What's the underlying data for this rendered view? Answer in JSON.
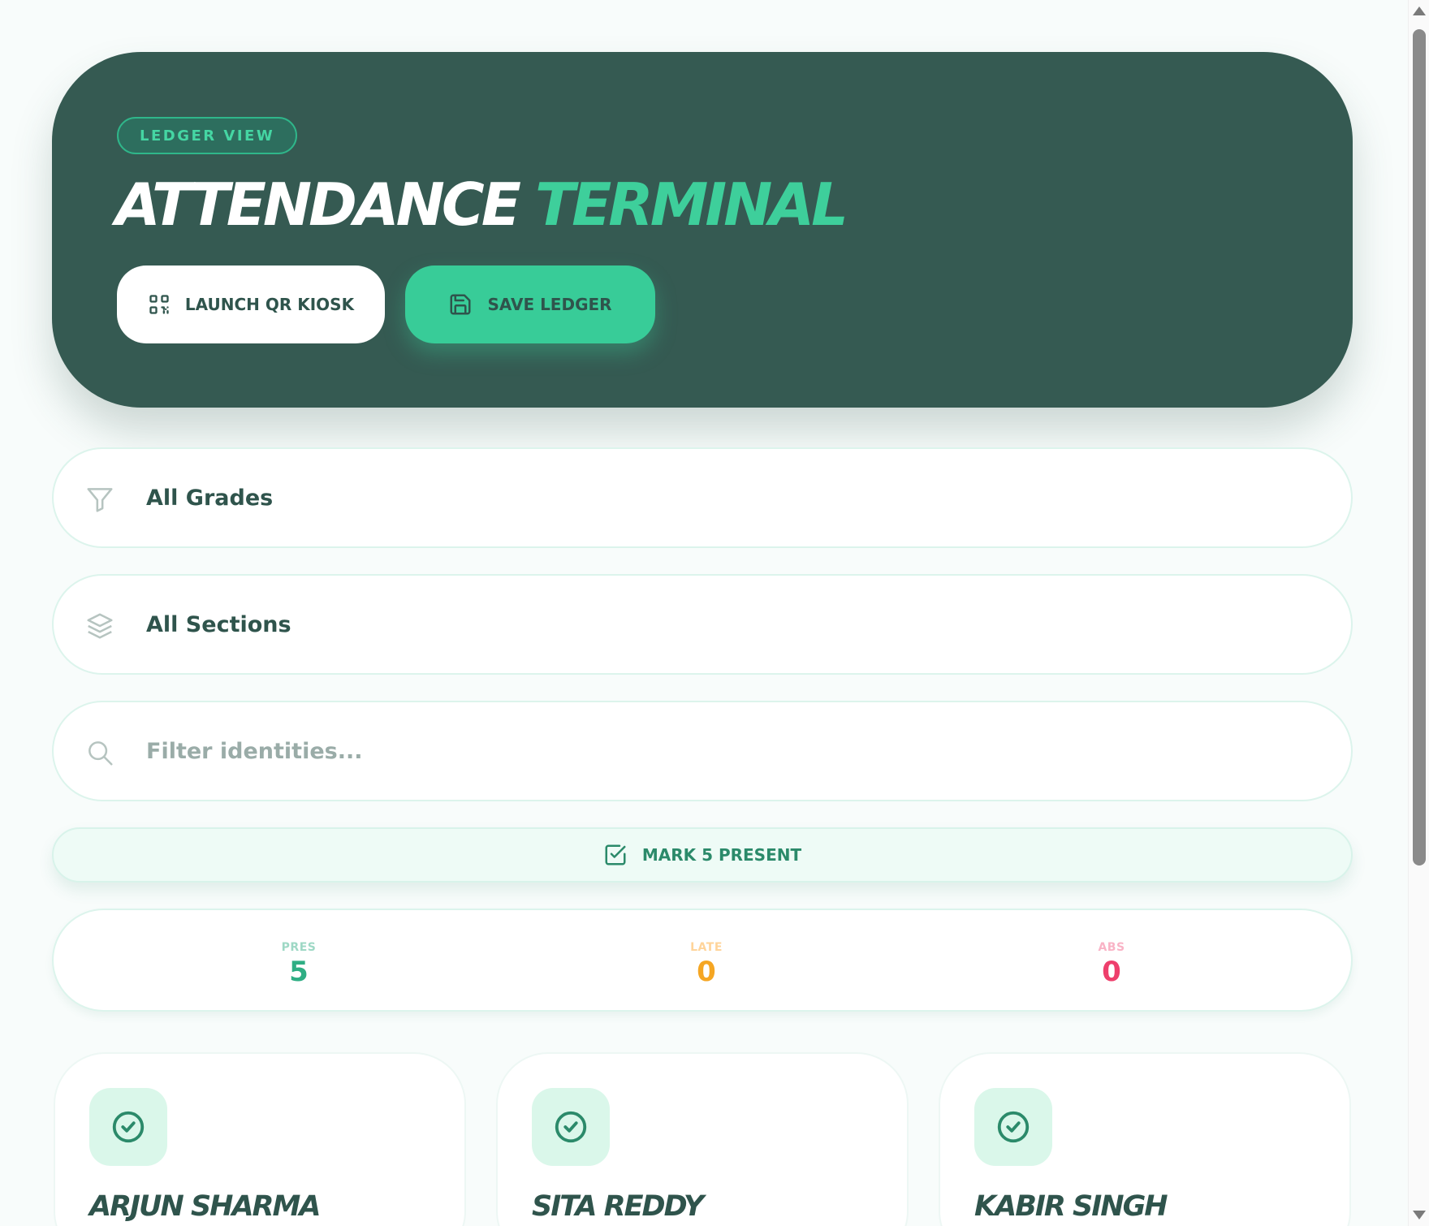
{
  "hero": {
    "badge": "LEDGER VIEW",
    "title_main": "ATTENDANCE",
    "title_accent": "TERMINAL",
    "kiosk_label": "LAUNCH QR KIOSK",
    "save_label": "SAVE LEDGER"
  },
  "filters": {
    "grade": {
      "value": "All Grades",
      "icon": "filter-icon"
    },
    "section": {
      "value": "All Sections",
      "icon": "layers-icon"
    },
    "search": {
      "placeholder": "Filter identities...",
      "icon": "search-icon"
    }
  },
  "bulk_action": {
    "label": "MARK 5 PRESENT",
    "icon": "check-square-icon"
  },
  "stats": {
    "present": {
      "label": "PRES",
      "value": "5"
    },
    "late": {
      "label": "LATE",
      "value": "0"
    },
    "absent": {
      "label": "ABS",
      "value": "0"
    }
  },
  "students": [
    {
      "name": "ARJUN SHARMA",
      "status_icon": "check-circle-icon"
    },
    {
      "name": "SITA REDDY",
      "status_icon": "check-circle-icon"
    },
    {
      "name": "KABIR SINGH",
      "status_icon": "check-circle-icon"
    }
  ],
  "colors": {
    "hero_bg": "#355a52",
    "accent": "#38cc98",
    "present": "#2fae84",
    "late": "#f5a623",
    "absent": "#ee3f6c"
  }
}
